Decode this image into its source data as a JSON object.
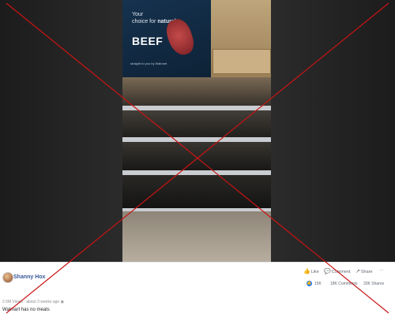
{
  "sign": {
    "line1": "Your",
    "line2": "choice for",
    "line2_bold": "natural",
    "title": "BEEF",
    "tagline": "straight to you by Walmart"
  },
  "post": {
    "author": "Shanny Hox",
    "views": "2.5M Views",
    "separator": "·",
    "time": "about 3 weeks ago",
    "caption": "Walmart has no meats"
  },
  "actions": {
    "like": "Like",
    "comment": "Comment",
    "share": "Share",
    "more": "···"
  },
  "counts": {
    "reactions": "15K",
    "comments": "18K Comments",
    "shares": "33K Shares"
  },
  "colors": {
    "author_link": "#385898",
    "reaction": "#1877f2",
    "x_mark": "#c81414"
  }
}
